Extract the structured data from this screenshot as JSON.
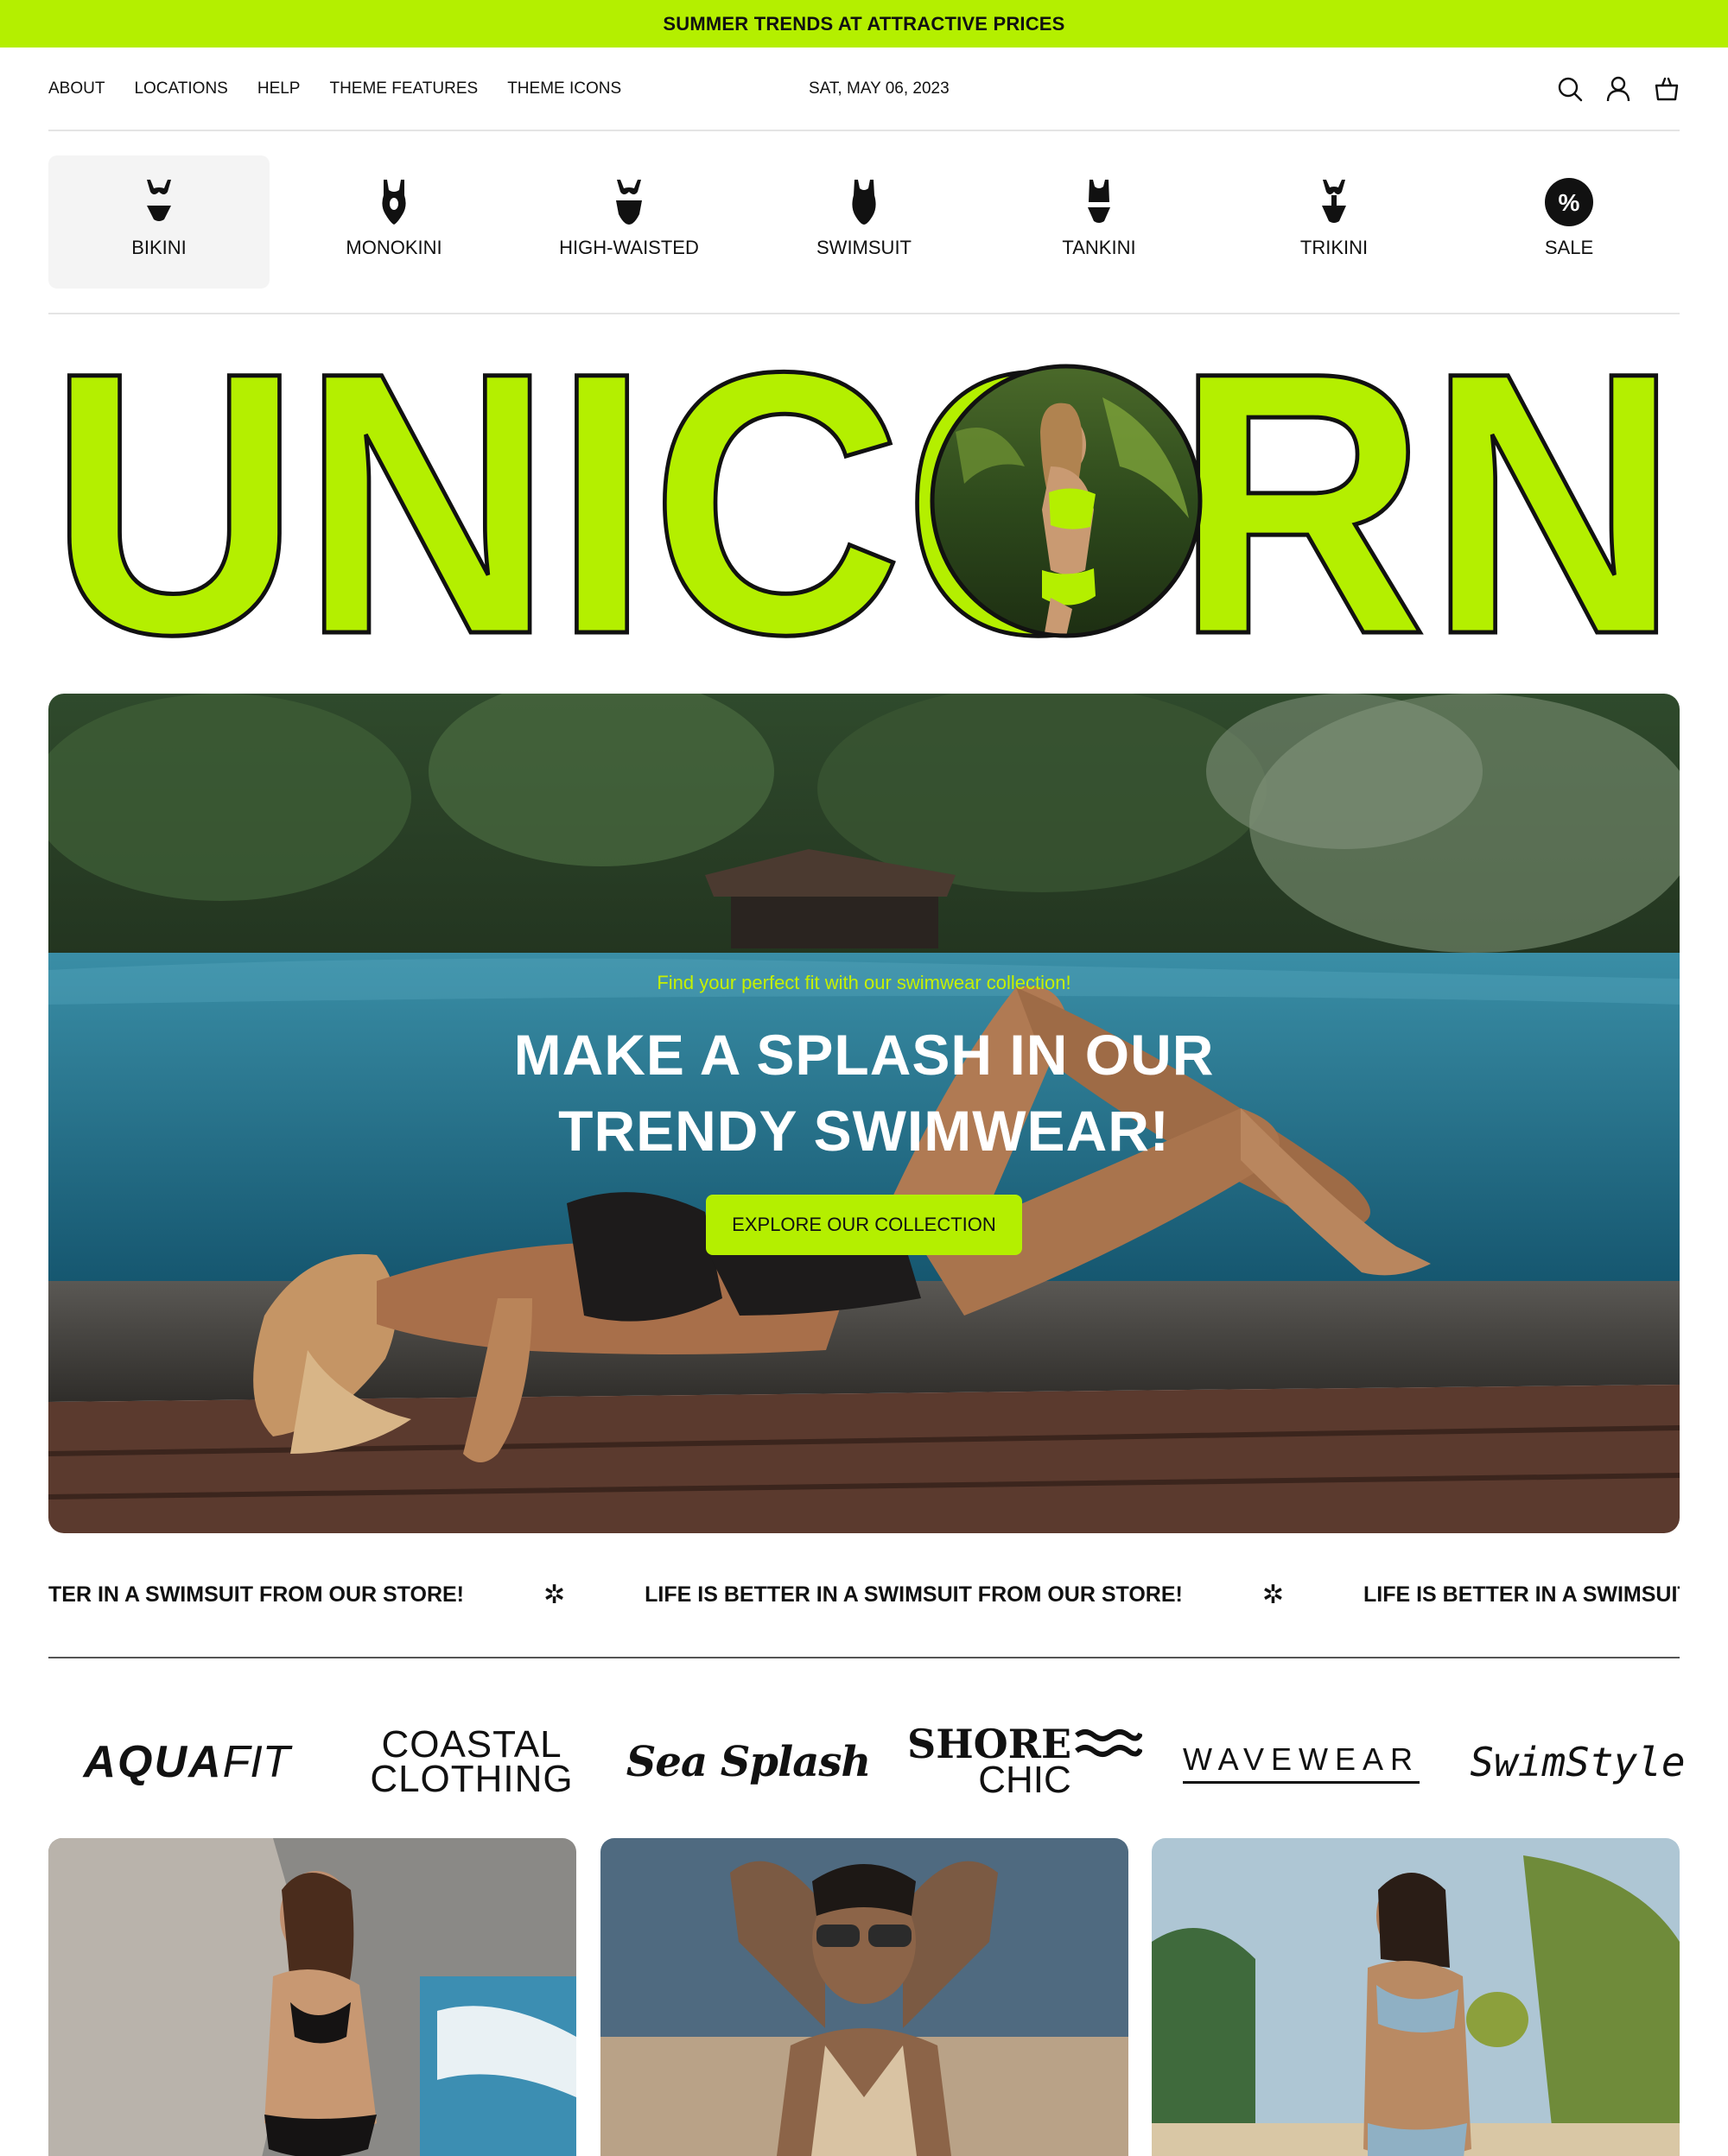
{
  "announcement": "SUMMER TRENDS AT ATTRACTIVE PRICES",
  "nav": {
    "links": [
      "ABOUT",
      "LOCATIONS",
      "HELP",
      "THEME FEATURES",
      "THEME ICONS"
    ],
    "date": "SAT, MAY 06, 2023",
    "icons": [
      "search-icon",
      "account-icon",
      "cart-icon"
    ]
  },
  "categories": [
    {
      "label": "BIKINI",
      "icon": "bikini-icon",
      "active": true
    },
    {
      "label": "MONOKINI",
      "icon": "monokini-icon"
    },
    {
      "label": "HIGH-WAISTED",
      "icon": "high-waisted-icon"
    },
    {
      "label": "SWIMSUIT",
      "icon": "swimsuit-icon"
    },
    {
      "label": "TANKINI",
      "icon": "tankini-icon"
    },
    {
      "label": "TRIKINI",
      "icon": "trikini-icon"
    },
    {
      "label": "SALE",
      "icon": "percent-icon"
    }
  ],
  "brand": {
    "text": "UNICORN",
    "fill_color": "#b4ef00"
  },
  "hero": {
    "kicker": "Find your perfect fit with our swimwear collection!",
    "title_line1": "MAKE A SPLASH IN OUR",
    "title_line2": "TRENDY SWIMWEAR!",
    "button": "EXPLORE OUR COLLECTION"
  },
  "marquee": {
    "text": "LIFE IS BETTER IN A SWIMSUIT FROM OUR STORE!",
    "partial_start": "TER IN A SWIMSUIT FROM OUR STORE!",
    "partial_end": "LIFE IS BETTER IN A SWIMSUIT FROM",
    "separator": "✲"
  },
  "logos": {
    "aqua_bold": "AQUA",
    "aqua_light": "FIT",
    "coastal_1": "COASTAL",
    "coastal_2": "CLOTHING",
    "seasplash": "Sea Splash",
    "shore_1": "SHORE",
    "shore_2": "CHIC",
    "wavewear": "WAVEWEAR",
    "swimstyle": "SwimStyle"
  },
  "colors": {
    "accent": "#b4ef00",
    "text": "#111111"
  }
}
